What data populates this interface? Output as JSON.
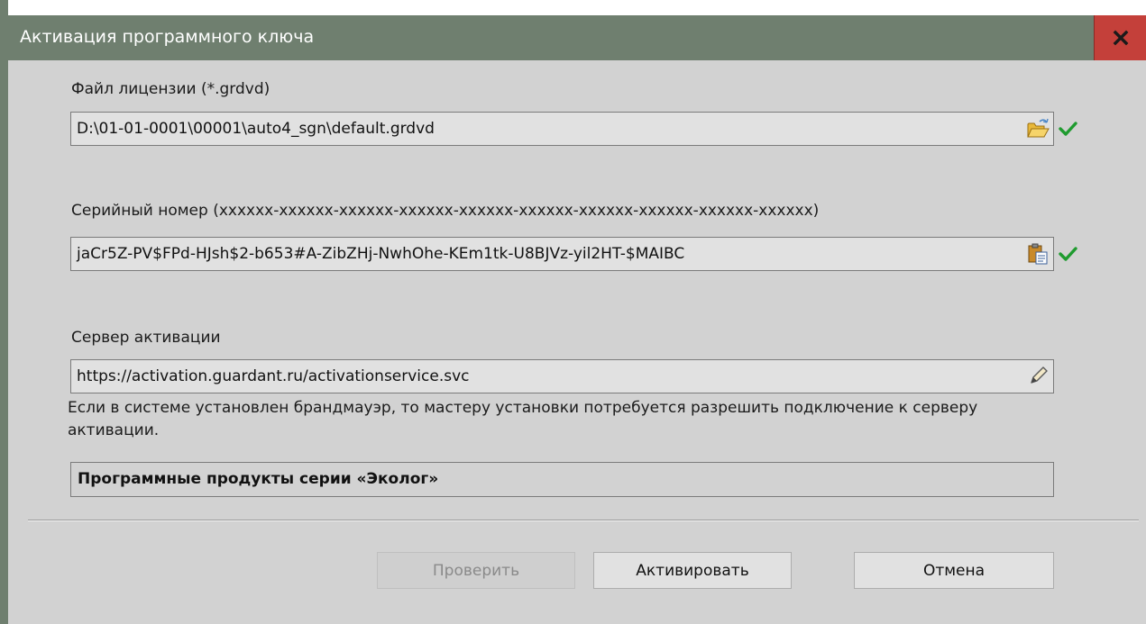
{
  "window": {
    "title": "Активация программного ключа"
  },
  "license": {
    "label": "Файл лицензии (*.grdvd)",
    "value": "D:\\01-01-0001\\00001\\auto4_sgn\\default.grdvd"
  },
  "serial": {
    "label": "Серийный номер (xxxxxx-xxxxxx-xxxxxx-xxxxxx-xxxxxx-xxxxxx-xxxxxx-xxxxxx-xxxxxx-xxxxxx)",
    "value": "jaCr5Z-PV$FPd-HJsh$2-b653#A-ZibZHj-NwhOhe-KEm1tk-U8BJVz-yil2HT-$MAIBC"
  },
  "server": {
    "label": "Сервер активации",
    "value": "https://activation.guardant.ru/activationservice.svc",
    "note": "Если в системе установлен брандмауэр, то мастеру установки потребуется разрешить подключение к серверу активации."
  },
  "product": {
    "text": "Программные продукты серии «Эколог»"
  },
  "buttons": {
    "check": "Проверить",
    "activate": "Активировать",
    "cancel": "Отмена"
  },
  "icons": {
    "close": "close-icon",
    "open_folder": "open-folder-icon",
    "paste": "paste-icon",
    "edit": "pencil-icon",
    "valid": "checkmark-icon"
  },
  "colors": {
    "titlebar": "#6f7f6f",
    "close": "#c4403a",
    "valid": "#1f9b2f"
  }
}
